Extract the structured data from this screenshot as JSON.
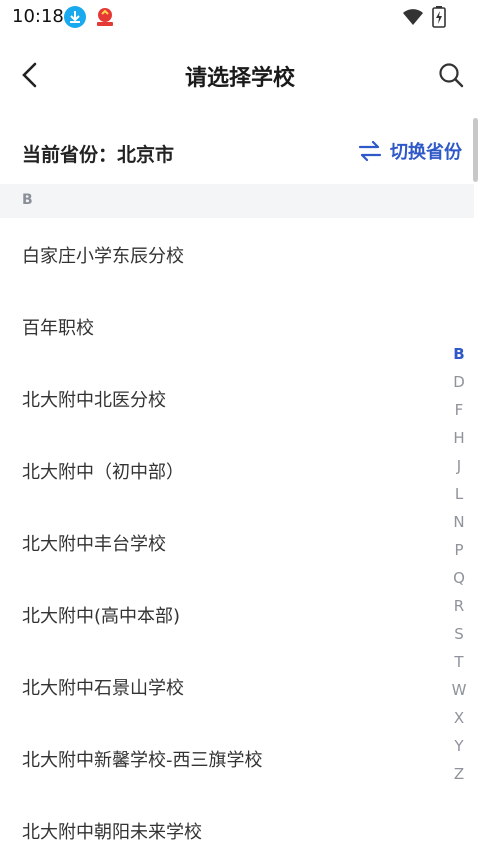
{
  "statusbar": {
    "time": "10:18"
  },
  "header": {
    "title": "请选择学校"
  },
  "province": {
    "current": "当前省份：北京市",
    "switch_label": "切换省份"
  },
  "section_letter": "B",
  "schools": [
    "白家庄小学东辰分校",
    "百年职校",
    "北大附中北医分校",
    "北大附中（初中部）",
    "北大附中丰台学校",
    "北大附中(高中本部)",
    "北大附中石景山学校",
    "北大附中新馨学校-西三旗学校",
    "北大附中朝阳未来学校"
  ],
  "index_letters": [
    "B",
    "D",
    "F",
    "H",
    "J",
    "L",
    "N",
    "P",
    "Q",
    "R",
    "S",
    "T",
    "W",
    "X",
    "Y",
    "Z"
  ],
  "active_letter": "B",
  "colors": {
    "accent": "#2f59c8",
    "section_bg": "#f4f5f7"
  }
}
